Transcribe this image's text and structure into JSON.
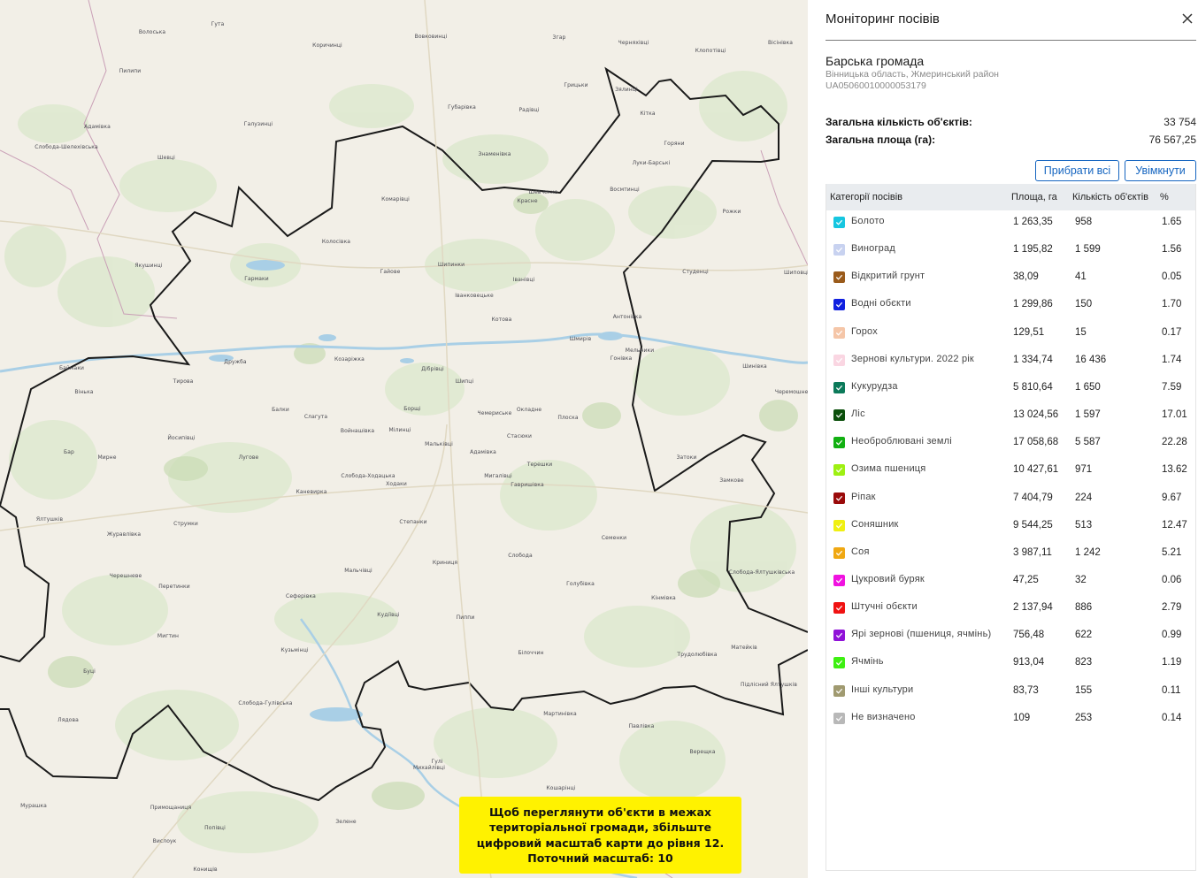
{
  "panel": {
    "title": "Моніторинг посівів",
    "close_icon": "close-icon",
    "community": {
      "name": "Барська громада",
      "region": "Вінницька область, Жмеринський район",
      "code": "UA05060010000053179"
    },
    "totals": {
      "objects_label": "Загальна кількість об'єктів:",
      "objects_value": "33 754",
      "area_label": "Загальна площа (га):",
      "area_value": "76 567,25"
    },
    "buttons": {
      "hide_all": "Прибрати всі",
      "enable": "Увімкнути"
    },
    "table": {
      "headers": [
        "Категорії посівів",
        "Площа, га",
        "Кількість об'єктів",
        "%"
      ],
      "rows": [
        {
          "name": "Болото",
          "area": "1 263,35",
          "count": "958",
          "pct": "1.65",
          "color": "#16c6e0"
        },
        {
          "name": "Виноград",
          "area": "1 195,82",
          "count": "1 599",
          "pct": "1.56",
          "color": "#c8d2f0"
        },
        {
          "name": "Відкритий грунт",
          "area": "38,09",
          "count": "41",
          "pct": "0.05",
          "color": "#9a5b1b"
        },
        {
          "name": "Водні обєкти",
          "area": "1 299,86",
          "count": "150",
          "pct": "1.70",
          "color": "#1020e0"
        },
        {
          "name": "Горох",
          "area": "129,51",
          "count": "15",
          "pct": "0.17",
          "color": "#f5c6a8"
        },
        {
          "name": "Зернові культури. 2022 рік",
          "area": "1 334,74",
          "count": "16 436",
          "pct": "1.74",
          "color": "#fad6e2"
        },
        {
          "name": "Кукурудза",
          "area": "5 810,64",
          "count": "1 650",
          "pct": "7.59",
          "color": "#0c7a5a"
        },
        {
          "name": "Ліс",
          "area": "13 024,56",
          "count": "1 597",
          "pct": "17.01",
          "color": "#0b4f0b"
        },
        {
          "name": "Необроблювані землі",
          "area": "17 058,68",
          "count": "5 587",
          "pct": "22.28",
          "color": "#12b012"
        },
        {
          "name": "Озима пшениця",
          "area": "10 427,61",
          "count": "971",
          "pct": "13.62",
          "color": "#9ef012"
        },
        {
          "name": "Ріпак",
          "area": "7 404,79",
          "count": "224",
          "pct": "9.67",
          "color": "#9a0a0a"
        },
        {
          "name": "Соняшник",
          "area": "9 544,25",
          "count": "513",
          "pct": "12.47",
          "color": "#f0f012"
        },
        {
          "name": "Соя",
          "area": "3 987,11",
          "count": "1 242",
          "pct": "5.21",
          "color": "#f0a812"
        },
        {
          "name": "Цукровий буряк",
          "area": "47,25",
          "count": "32",
          "pct": "0.06",
          "color": "#f012e0"
        },
        {
          "name": "Штучні обєкти",
          "area": "2 137,94",
          "count": "886",
          "pct": "2.79",
          "color": "#f01212"
        },
        {
          "name": "Ярі зернові (пшениця, ячмінь)",
          "area": "756,48",
          "count": "622",
          "pct": "0.99",
          "color": "#9012d8"
        },
        {
          "name": "Ячмінь",
          "area": "913,04",
          "count": "823",
          "pct": "1.19",
          "color": "#3ef012"
        },
        {
          "name": "Інші культури",
          "area": "83,73",
          "count": "155",
          "pct": "0.11",
          "color": "#a09a70"
        },
        {
          "name": "Не визначено",
          "area": "109",
          "count": "253",
          "pct": "0.14",
          "color": "#b8b8b8"
        }
      ]
    }
  },
  "map": {
    "notice": "Щоб переглянути об'єкти в межах територіальної громади, збільште цифровий масштаб карти до рівня 12. Поточний масштаб: 10",
    "places": [
      "Волоська",
      "Гута",
      "Коричинці",
      "Вовковинці",
      "Згар",
      "Черняхівці",
      "Клопотівці",
      "Вісінівка",
      "Пилипи",
      "Грицьки",
      "Радівці",
      "Зялинці",
      "Адамівка",
      "Галузинці",
      "Кітка",
      "Слобода-Шелехівська",
      "Шевці",
      "Горяни",
      "Луки-Барські",
      "Шевченко",
      "Восмтинці",
      "Комарівці",
      "Рожки",
      "Колосівка",
      "Якушинці",
      "Гармаки",
      "Гайове",
      "Шипинки",
      "Іванівці",
      "Іванковецьке",
      "Студенці",
      "Котова",
      "Антонівка",
      "Шмирів",
      "Шиповці",
      "Мельники",
      "Гонівка",
      "Шинівка",
      "Вінька",
      "Баймаки",
      "Тирова",
      "Дружба",
      "Козаріжка",
      "Дібрівці",
      "Шипці",
      "Черемошне-Барські",
      "Балки",
      "Слагута",
      "Борщі",
      "Чемериське",
      "Окладне",
      "Плоска",
      "Войнашівка",
      "Мілинці",
      "Мальківці",
      "Стасюки",
      "Адамівка",
      "Йосипівці",
      "Бар",
      "Мирне",
      "Луговe",
      "Слобода-Ходацька",
      "Ходаки",
      "Мигалівці",
      "Терешки",
      "Гавришівка",
      "Затоки",
      "Замкове",
      "Каневирка",
      "Струмки",
      "Степанки",
      "Журавлівка",
      "Ялтушків",
      "Семенки",
      "Черешневе",
      "Перетинки",
      "Мальчівці",
      "Криниця",
      "Слобода",
      "Слобода-Ялтушківська",
      "Сеферівка",
      "Голубівка",
      "Кінмівка",
      "Кудіївці",
      "Пиппи",
      "Мигтин",
      "Матейків",
      "Буці",
      "Кузьмінці",
      "Білоччин",
      "Трудолюбівка",
      "Слобода-Гулівська",
      "Лядова",
      "Мартинівка",
      "Павлівка",
      "Підлісний Ялтушків",
      "Гулі",
      "Верещка",
      "Кошарінці",
      "Мурашка",
      "Примощаниця",
      "Попівці",
      "Зелене",
      "Вислоук",
      "Конищів",
      "Михайлівці",
      "Губарівка",
      "Знаменівка",
      "Красне"
    ]
  }
}
